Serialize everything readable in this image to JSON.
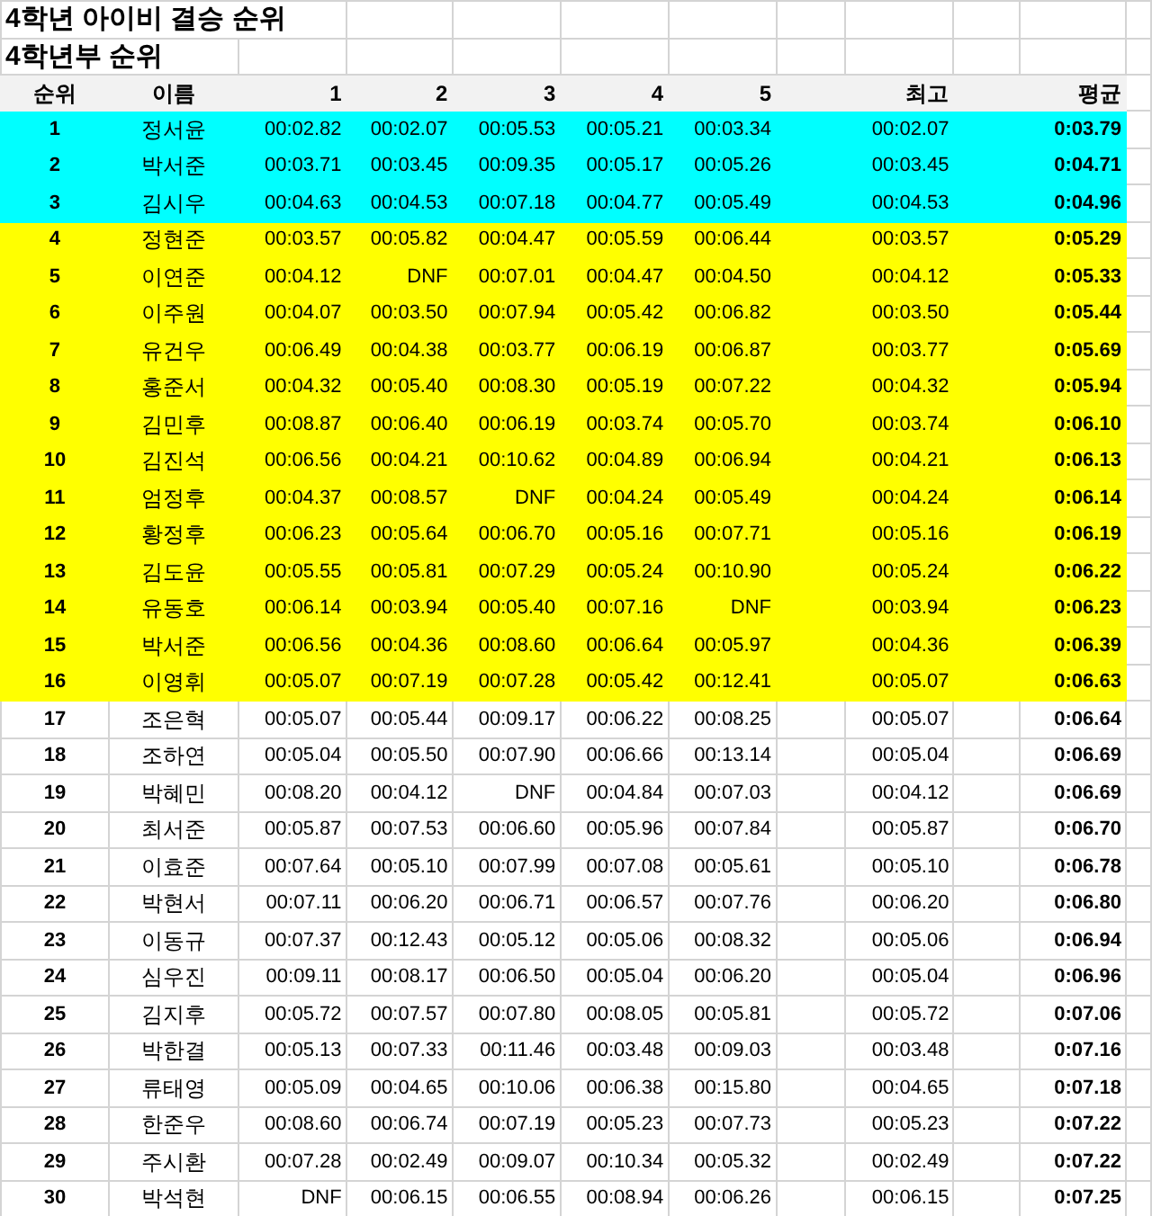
{
  "title": "4학년 아이비 결승 순위",
  "subtitle": "4학년부 순위",
  "columns": {
    "rank": "순위",
    "name": "이름",
    "runs": [
      "1",
      "2",
      "3",
      "4",
      "5"
    ],
    "best": "최고",
    "average": "평균"
  },
  "rows": [
    {
      "rank": "1",
      "name": "정서윤",
      "times": [
        "00:02.82",
        "00:02.07",
        "00:05.53",
        "00:05.21",
        "00:03.34"
      ],
      "best": "00:02.07",
      "average": "0:03.79",
      "color": "#00ffff"
    },
    {
      "rank": "2",
      "name": "박서준",
      "times": [
        "00:03.71",
        "00:03.45",
        "00:09.35",
        "00:05.17",
        "00:05.26"
      ],
      "best": "00:03.45",
      "average": "0:04.71",
      "color": "#00ffff"
    },
    {
      "rank": "3",
      "name": "김시우",
      "times": [
        "00:04.63",
        "00:04.53",
        "00:07.18",
        "00:04.77",
        "00:05.49"
      ],
      "best": "00:04.53",
      "average": "0:04.96",
      "color": "#00ffff"
    },
    {
      "rank": "4",
      "name": "정현준",
      "times": [
        "00:03.57",
        "00:05.82",
        "00:04.47",
        "00:05.59",
        "00:06.44"
      ],
      "best": "00:03.57",
      "average": "0:05.29",
      "color": "#ffff00"
    },
    {
      "rank": "5",
      "name": "이연준",
      "times": [
        "00:04.12",
        "DNF",
        "00:07.01",
        "00:04.47",
        "00:04.50"
      ],
      "best": "00:04.12",
      "average": "0:05.33",
      "color": "#ffff00"
    },
    {
      "rank": "6",
      "name": "이주원",
      "times": [
        "00:04.07",
        "00:03.50",
        "00:07.94",
        "00:05.42",
        "00:06.82"
      ],
      "best": "00:03.50",
      "average": "0:05.44",
      "color": "#ffff00"
    },
    {
      "rank": "7",
      "name": "유건우",
      "times": [
        "00:06.49",
        "00:04.38",
        "00:03.77",
        "00:06.19",
        "00:06.87"
      ],
      "best": "00:03.77",
      "average": "0:05.69",
      "color": "#ffff00"
    },
    {
      "rank": "8",
      "name": "홍준서",
      "times": [
        "00:04.32",
        "00:05.40",
        "00:08.30",
        "00:05.19",
        "00:07.22"
      ],
      "best": "00:04.32",
      "average": "0:05.94",
      "color": "#ffff00"
    },
    {
      "rank": "9",
      "name": "김민후",
      "times": [
        "00:08.87",
        "00:06.40",
        "00:06.19",
        "00:03.74",
        "00:05.70"
      ],
      "best": "00:03.74",
      "average": "0:06.10",
      "color": "#ffff00"
    },
    {
      "rank": "10",
      "name": "김진석",
      "times": [
        "00:06.56",
        "00:04.21",
        "00:10.62",
        "00:04.89",
        "00:06.94"
      ],
      "best": "00:04.21",
      "average": "0:06.13",
      "color": "#ffff00"
    },
    {
      "rank": "11",
      "name": "엄정후",
      "times": [
        "00:04.37",
        "00:08.57",
        "DNF",
        "00:04.24",
        "00:05.49"
      ],
      "best": "00:04.24",
      "average": "0:06.14",
      "color": "#ffff00"
    },
    {
      "rank": "12",
      "name": "황정후",
      "times": [
        "00:06.23",
        "00:05.64",
        "00:06.70",
        "00:05.16",
        "00:07.71"
      ],
      "best": "00:05.16",
      "average": "0:06.19",
      "color": "#ffff00"
    },
    {
      "rank": "13",
      "name": "김도윤",
      "times": [
        "00:05.55",
        "00:05.81",
        "00:07.29",
        "00:05.24",
        "00:10.90"
      ],
      "best": "00:05.24",
      "average": "0:06.22",
      "color": "#ffff00"
    },
    {
      "rank": "14",
      "name": "유동호",
      "times": [
        "00:06.14",
        "00:03.94",
        "00:05.40",
        "00:07.16",
        "DNF"
      ],
      "best": "00:03.94",
      "average": "0:06.23",
      "color": "#ffff00"
    },
    {
      "rank": "15",
      "name": "박서준",
      "times": [
        "00:06.56",
        "00:04.36",
        "00:08.60",
        "00:06.64",
        "00:05.97"
      ],
      "best": "00:04.36",
      "average": "0:06.39",
      "color": "#ffff00"
    },
    {
      "rank": "16",
      "name": "이영휘",
      "times": [
        "00:05.07",
        "00:07.19",
        "00:07.28",
        "00:05.42",
        "00:12.41"
      ],
      "best": "00:05.07",
      "average": "0:06.63",
      "color": "#ffff00"
    },
    {
      "rank": "17",
      "name": "조은혁",
      "times": [
        "00:05.07",
        "00:05.44",
        "00:09.17",
        "00:06.22",
        "00:08.25"
      ],
      "best": "00:05.07",
      "average": "0:06.64",
      "color": "#ffffff"
    },
    {
      "rank": "18",
      "name": "조하연",
      "times": [
        "00:05.04",
        "00:05.50",
        "00:07.90",
        "00:06.66",
        "00:13.14"
      ],
      "best": "00:05.04",
      "average": "0:06.69",
      "color": "#ffffff"
    },
    {
      "rank": "19",
      "name": "박혜민",
      "times": [
        "00:08.20",
        "00:04.12",
        "DNF",
        "00:04.84",
        "00:07.03"
      ],
      "best": "00:04.12",
      "average": "0:06.69",
      "color": "#ffffff"
    },
    {
      "rank": "20",
      "name": "최서준",
      "times": [
        "00:05.87",
        "00:07.53",
        "00:06.60",
        "00:05.96",
        "00:07.84"
      ],
      "best": "00:05.87",
      "average": "0:06.70",
      "color": "#ffffff"
    },
    {
      "rank": "21",
      "name": "이효준",
      "times": [
        "00:07.64",
        "00:05.10",
        "00:07.99",
        "00:07.08",
        "00:05.61"
      ],
      "best": "00:05.10",
      "average": "0:06.78",
      "color": "#ffffff"
    },
    {
      "rank": "22",
      "name": "박현서",
      "times": [
        "00:07.11",
        "00:06.20",
        "00:06.71",
        "00:06.57",
        "00:07.76"
      ],
      "best": "00:06.20",
      "average": "0:06.80",
      "color": "#ffffff"
    },
    {
      "rank": "23",
      "name": "이동규",
      "times": [
        "00:07.37",
        "00:12.43",
        "00:05.12",
        "00:05.06",
        "00:08.32"
      ],
      "best": "00:05.06",
      "average": "0:06.94",
      "color": "#ffffff"
    },
    {
      "rank": "24",
      "name": "심우진",
      "times": [
        "00:09.11",
        "00:08.17",
        "00:06.50",
        "00:05.04",
        "00:06.20"
      ],
      "best": "00:05.04",
      "average": "0:06.96",
      "color": "#ffffff"
    },
    {
      "rank": "25",
      "name": "김지후",
      "times": [
        "00:05.72",
        "00:07.57",
        "00:07.80",
        "00:08.05",
        "00:05.81"
      ],
      "best": "00:05.72",
      "average": "0:07.06",
      "color": "#ffffff"
    },
    {
      "rank": "26",
      "name": "박한결",
      "times": [
        "00:05.13",
        "00:07.33",
        "00:11.46",
        "00:03.48",
        "00:09.03"
      ],
      "best": "00:03.48",
      "average": "0:07.16",
      "color": "#ffffff"
    },
    {
      "rank": "27",
      "name": "류태영",
      "times": [
        "00:05.09",
        "00:04.65",
        "00:10.06",
        "00:06.38",
        "00:15.80"
      ],
      "best": "00:04.65",
      "average": "0:07.18",
      "color": "#ffffff"
    },
    {
      "rank": "28",
      "name": "한준우",
      "times": [
        "00:08.60",
        "00:06.74",
        "00:07.19",
        "00:05.23",
        "00:07.73"
      ],
      "best": "00:05.23",
      "average": "0:07.22",
      "color": "#ffffff"
    },
    {
      "rank": "29",
      "name": "주시환",
      "times": [
        "00:07.28",
        "00:02.49",
        "00:09.07",
        "00:10.34",
        "00:05.32"
      ],
      "best": "00:02.49",
      "average": "0:07.22",
      "color": "#ffffff"
    },
    {
      "rank": "30",
      "name": "박석현",
      "times": [
        "DNF",
        "00:06.15",
        "00:06.55",
        "00:08.94",
        "00:06.26"
      ],
      "best": "00:06.15",
      "average": "0:07.25",
      "color": "#ffffff"
    }
  ]
}
